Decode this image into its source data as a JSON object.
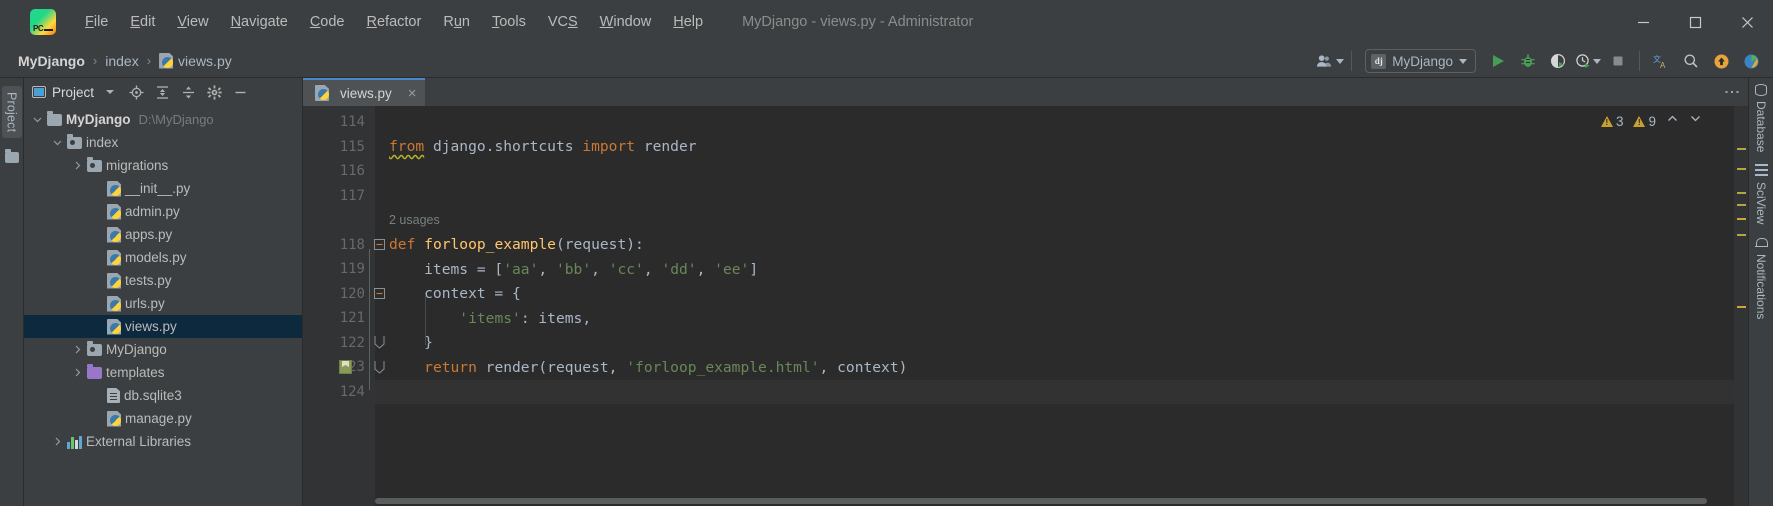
{
  "titlebar": {
    "app_icon": "pycharm-logo",
    "window_title": "MyDjango - views.py - Administrator",
    "menus": [
      {
        "label": "File",
        "mnemonic": "F"
      },
      {
        "label": "Edit",
        "mnemonic": "E"
      },
      {
        "label": "View",
        "mnemonic": "V"
      },
      {
        "label": "Navigate",
        "mnemonic": "N"
      },
      {
        "label": "Code",
        "mnemonic": "C"
      },
      {
        "label": "Refactor",
        "mnemonic": "R"
      },
      {
        "label": "Run",
        "mnemonic": "u"
      },
      {
        "label": "Tools",
        "mnemonic": "T"
      },
      {
        "label": "VCS",
        "mnemonic": "S"
      },
      {
        "label": "Window",
        "mnemonic": "W"
      },
      {
        "label": "Help",
        "mnemonic": "H"
      }
    ],
    "controls": {
      "minimize": "minimize-icon",
      "maximize": "maximize-icon",
      "close": "close-icon"
    }
  },
  "navbar": {
    "breadcrumbs": [
      {
        "label": "MyDjango",
        "icon": null,
        "bold": true
      },
      {
        "label": "index",
        "icon": null,
        "bold": false
      },
      {
        "label": "views.py",
        "icon": "python-file-icon",
        "bold": false
      }
    ],
    "separator": "›",
    "run_config": {
      "icon": "django-icon",
      "icon_text": "dj",
      "label": "MyDjango"
    },
    "actions": [
      {
        "name": "user-account-icon"
      },
      {
        "name": "run-button"
      },
      {
        "name": "debug-button"
      },
      {
        "name": "run-coverage-button"
      },
      {
        "name": "profile-button"
      },
      {
        "name": "stop-button"
      },
      {
        "name": "translate-icon"
      },
      {
        "name": "search-everywhere-icon"
      },
      {
        "name": "update-icon"
      },
      {
        "name": "plugin-icon"
      }
    ]
  },
  "left_strip": {
    "tab_label": "Project",
    "folder_icon": "folder-icon"
  },
  "project_panel": {
    "title": "Project",
    "header_icons": [
      "project-view-icon",
      "dropdown-caret-icon",
      "locate-icon",
      "expand-all-icon",
      "collapse-all-icon",
      "settings-gear-icon",
      "hide-panel-icon"
    ],
    "tree": [
      {
        "label": "MyDjango",
        "path": "D:\\MyDjango",
        "icon": "folder",
        "indent": 0,
        "arrow": "down",
        "bold": true,
        "selected": false
      },
      {
        "label": "index",
        "path": "",
        "icon": "module-folder",
        "indent": 1,
        "arrow": "down",
        "bold": false,
        "selected": false
      },
      {
        "label": "migrations",
        "path": "",
        "icon": "module-folder",
        "indent": 2,
        "arrow": "right",
        "bold": false,
        "selected": false
      },
      {
        "label": "__init__.py",
        "path": "",
        "icon": "python",
        "indent": 3,
        "arrow": "none",
        "bold": false,
        "selected": false
      },
      {
        "label": "admin.py",
        "path": "",
        "icon": "python",
        "indent": 3,
        "arrow": "none",
        "bold": false,
        "selected": false
      },
      {
        "label": "apps.py",
        "path": "",
        "icon": "python",
        "indent": 3,
        "arrow": "none",
        "bold": false,
        "selected": false
      },
      {
        "label": "models.py",
        "path": "",
        "icon": "python",
        "indent": 3,
        "arrow": "none",
        "bold": false,
        "selected": false
      },
      {
        "label": "tests.py",
        "path": "",
        "icon": "python",
        "indent": 3,
        "arrow": "none",
        "bold": false,
        "selected": false
      },
      {
        "label": "urls.py",
        "path": "",
        "icon": "python",
        "indent": 3,
        "arrow": "none",
        "bold": false,
        "selected": false
      },
      {
        "label": "views.py",
        "path": "",
        "icon": "python",
        "indent": 3,
        "arrow": "none",
        "bold": false,
        "selected": true
      },
      {
        "label": "MyDjango",
        "path": "",
        "icon": "module-folder",
        "indent": 2,
        "arrow": "right",
        "bold": false,
        "selected": false
      },
      {
        "label": "templates",
        "path": "",
        "icon": "template-folder",
        "indent": 2,
        "arrow": "right",
        "bold": false,
        "selected": false
      },
      {
        "label": "db.sqlite3",
        "path": "",
        "icon": "db-file",
        "indent": 3,
        "arrow": "none",
        "bold": false,
        "selected": false
      },
      {
        "label": "manage.py",
        "path": "",
        "icon": "python",
        "indent": 3,
        "arrow": "none",
        "bold": false,
        "selected": false
      },
      {
        "label": "External Libraries",
        "path": "",
        "icon": "library",
        "indent": 1,
        "arrow": "right",
        "bold": false,
        "selected": false
      }
    ]
  },
  "editor": {
    "tab": {
      "label": "views.py",
      "icon": "python-file-icon",
      "close": "×"
    },
    "options_icon": "more-options-icon",
    "inspections": {
      "warnings_primary": "3",
      "warnings_secondary": "9",
      "prev_icon": "chevron-up-icon",
      "next_icon": "chevron-down-icon"
    },
    "first_line": 114,
    "lines": [
      {
        "n": "114",
        "tokens": [],
        "fold": "none",
        "bookmark": false,
        "current": false
      },
      {
        "n": "115",
        "tokens": [
          {
            "t": "from",
            "c": "kw",
            "squiggly": true
          },
          {
            "t": " django.shortcuts ",
            "c": "txt"
          },
          {
            "t": "import",
            "c": "kw"
          },
          {
            "t": " render",
            "c": "txt"
          }
        ],
        "fold": "none",
        "bookmark": false,
        "current": false
      },
      {
        "n": "116",
        "tokens": [],
        "fold": "none",
        "bookmark": false,
        "current": false
      },
      {
        "n": "117",
        "tokens": [],
        "fold": "none",
        "bookmark": false,
        "current": false
      },
      {
        "n": "",
        "inlay": "2 usages",
        "tokens": [],
        "fold": "none",
        "bookmark": false,
        "current": false
      },
      {
        "n": "118",
        "tokens": [
          {
            "t": "def",
            "c": "kw"
          },
          {
            "t": " ",
            "c": "txt"
          },
          {
            "t": "forloop_example",
            "c": "fn"
          },
          {
            "t": "(request):",
            "c": "txt"
          }
        ],
        "fold": "start",
        "bookmark": false,
        "current": false
      },
      {
        "n": "119",
        "tokens": [
          {
            "t": "    items = [",
            "c": "txt"
          },
          {
            "t": "'aa'",
            "c": "str"
          },
          {
            "t": ", ",
            "c": "txt"
          },
          {
            "t": "'bb'",
            "c": "str"
          },
          {
            "t": ", ",
            "c": "txt"
          },
          {
            "t": "'cc'",
            "c": "str"
          },
          {
            "t": ", ",
            "c": "txt"
          },
          {
            "t": "'dd'",
            "c": "str"
          },
          {
            "t": ", ",
            "c": "txt"
          },
          {
            "t": "'ee'",
            "c": "str"
          },
          {
            "t": "]",
            "c": "txt"
          }
        ],
        "fold": "none",
        "bookmark": false,
        "current": false
      },
      {
        "n": "120",
        "tokens": [
          {
            "t": "    context = {",
            "c": "txt"
          }
        ],
        "fold": "start",
        "bookmark": false,
        "current": false
      },
      {
        "n": "121",
        "tokens": [
          {
            "t": "        ",
            "c": "txt"
          },
          {
            "t": "'items'",
            "c": "str"
          },
          {
            "t": ": items,",
            "c": "txt"
          }
        ],
        "fold": "none",
        "bookmark": false,
        "current": false
      },
      {
        "n": "122",
        "tokens": [
          {
            "t": "    }",
            "c": "txt"
          }
        ],
        "fold": "end",
        "bookmark": false,
        "current": false
      },
      {
        "n": "123",
        "tokens": [
          {
            "t": "    ",
            "c": "txt"
          },
          {
            "t": "return",
            "c": "kw"
          },
          {
            "t": " render(request, ",
            "c": "txt"
          },
          {
            "t": "'forloop_example.html'",
            "c": "str"
          },
          {
            "t": ", context)",
            "c": "txt"
          }
        ],
        "fold": "end",
        "bookmark": true,
        "current": false
      },
      {
        "n": "124",
        "tokens": [],
        "fold": "none",
        "bookmark": false,
        "current": true
      }
    ]
  },
  "right_strip": {
    "tabs": [
      {
        "label": "Database",
        "icon": "database-icon"
      },
      {
        "label": "SciView",
        "icon": "sciview-icon"
      },
      {
        "label": "Notifications",
        "icon": "notifications-bell-icon"
      }
    ]
  },
  "colors": {
    "bg_panel": "#3c3f41",
    "bg_editor": "#2b2b2b",
    "accent_tab": "#4a88c7",
    "selection": "#0d293e",
    "keyword": "#cc7832",
    "string": "#6a8759",
    "function": "#ffc66d",
    "text": "#a9b7c6",
    "run_green": "#499c54",
    "warning": "#c9a032"
  }
}
